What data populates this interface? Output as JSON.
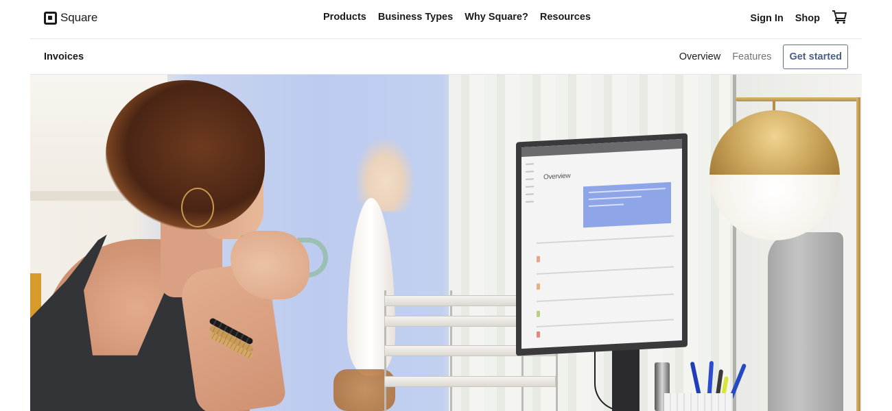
{
  "header": {
    "brand": {
      "name": "Square",
      "icon": "square-logo-icon"
    },
    "primary_nav": [
      {
        "label": "Products"
      },
      {
        "label": "Business Types"
      },
      {
        "label": "Why Square?"
      },
      {
        "label": "Resources"
      }
    ],
    "utility_nav": {
      "sign_in": "Sign In",
      "shop": "Shop",
      "cart_icon": "shopping-cart-icon"
    }
  },
  "subnav": {
    "title": "Invoices",
    "links": [
      {
        "label": "Overview",
        "state": "active"
      },
      {
        "label": "Features",
        "state": "inactive"
      }
    ],
    "cta": "Get started"
  },
  "hero": {
    "image_description": "Woman sipping from a mug while looking at a desktop monitor showing the Square Invoices overview dashboard, with a brass globe lamp and letter trays on the desk",
    "monitor_screen_title": "Overview"
  },
  "colors": {
    "text_primary": "#1a1a1a",
    "text_muted": "#737373",
    "cta_text": "#4a5f85",
    "cta_border": "#5f6f8b",
    "divider": "#e6e6e6"
  }
}
